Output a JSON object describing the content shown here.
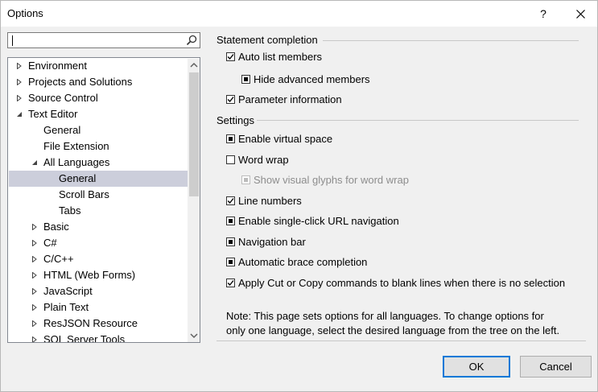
{
  "window": {
    "title": "Options",
    "help_label": "?"
  },
  "search": {
    "value": ""
  },
  "tree": {
    "items": [
      {
        "label": "Environment"
      },
      {
        "label": "Projects and Solutions"
      },
      {
        "label": "Source Control"
      },
      {
        "label": "Text Editor"
      },
      {
        "label": "General"
      },
      {
        "label": "File Extension"
      },
      {
        "label": "All Languages"
      },
      {
        "label": "General"
      },
      {
        "label": "Scroll Bars"
      },
      {
        "label": "Tabs"
      },
      {
        "label": "Basic"
      },
      {
        "label": "C#"
      },
      {
        "label": "C/C++"
      },
      {
        "label": "HTML (Web Forms)"
      },
      {
        "label": "JavaScript"
      },
      {
        "label": "Plain Text"
      },
      {
        "label": "ResJSON Resource"
      },
      {
        "label": "SQL Server Tools"
      }
    ]
  },
  "statement_completion": {
    "heading": "Statement completion",
    "auto_list_members": "Auto list members",
    "hide_advanced_members": "Hide advanced members",
    "parameter_information": "Parameter information"
  },
  "settings": {
    "heading": "Settings",
    "enable_virtual_space": "Enable virtual space",
    "word_wrap": "Word wrap",
    "show_visual_glyphs": "Show visual glyphs for word wrap",
    "line_numbers": "Line numbers",
    "single_click_url": "Enable single-click URL navigation",
    "navigation_bar": "Navigation bar",
    "automatic_brace": "Automatic brace completion",
    "apply_cut_copy": "Apply Cut or Copy commands to blank lines when there is no selection"
  },
  "note": {
    "line1": "Note: This page sets options for all languages. To change options for",
    "line2": "only one language, select the desired language from the tree on the left."
  },
  "buttons": {
    "ok": "OK",
    "cancel": "Cancel"
  }
}
